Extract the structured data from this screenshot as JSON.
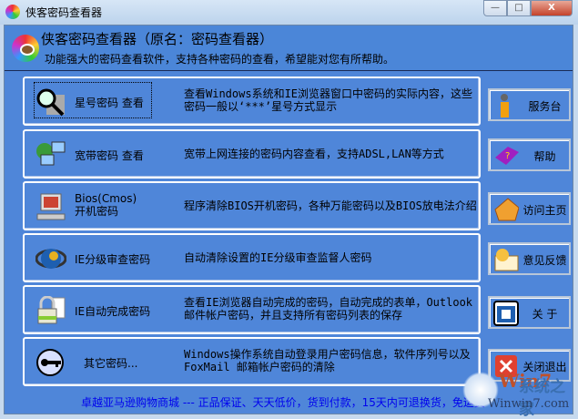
{
  "window": {
    "title": "侠客密码查看器",
    "buttons": {
      "minimize": "—",
      "maximize": "□",
      "close": "X"
    }
  },
  "header": {
    "title": "侠客密码查看器（原名：密码查看器）",
    "subtitle": "功能强大的密码查看软件，支持各种密码的查看，希望能对您有所帮助。"
  },
  "rows": [
    {
      "label": "星号密码 查看",
      "icon": "magnifier-icon",
      "desc": "查看Windows系统和IE浏览器窗口中密码的实际内容，这些密码一般以‘***’星号方式显示"
    },
    {
      "label": "宽带密码 查看",
      "icon": "network-icon",
      "desc": "宽带上网连接的密码内容查看，支持ADSL,LAN等方式"
    },
    {
      "label_line1": "Bios(Cmos)",
      "label_line2": "开机密码",
      "icon": "computer-icon",
      "desc": "程序清除BIOS开机密码，各种万能密码以及BIOS放电法介绍"
    },
    {
      "label": "IE分级审查密码",
      "icon": "ie-icon",
      "desc": "自动清除设置的IE分级审查监督人密码"
    },
    {
      "label": "IE自动完成密码",
      "icon": "lock-icon",
      "desc": "查看IE浏览器自动完成的密码，自动完成的表单，Outlook邮件帐户密码，并且支持所有密码列表的保存"
    },
    {
      "label": "其它密码...",
      "icon": "key-icon",
      "desc": "Windows操作系统自动登录用户密码信息，软件序列号以及FoxMail 邮箱帐户密码的清除"
    }
  ],
  "side_buttons": [
    {
      "label": "服务台",
      "icon": "person-icon"
    },
    {
      "label": "帮助",
      "icon": "help-book-icon"
    },
    {
      "label": "访问主页",
      "icon": "home-icon"
    },
    {
      "label": "意见反馈",
      "icon": "mail-icon"
    },
    {
      "label": "关 于",
      "icon": "about-icon"
    },
    {
      "label": "关闭退出",
      "icon": "close-x-icon"
    }
  ],
  "footer": {
    "link": "卓越亚马逊购物商城 --- 正品保证、天天低价，货到付款，15天内可退换货，免运费"
  },
  "watermark": {
    "brand": "Win7",
    "cn": "系统之家",
    "url": "Winwin7.com"
  }
}
